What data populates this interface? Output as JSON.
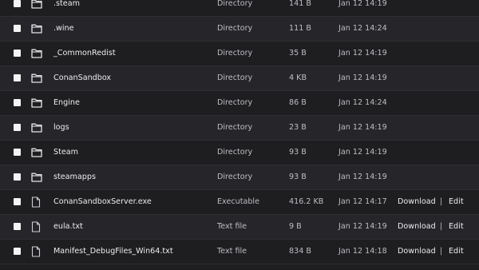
{
  "colors": {
    "background": "#1e1e21",
    "row_alt": "#26262a",
    "folder_icon": "#e6e6e8",
    "file_icon": "#cfcfd4"
  },
  "actions": {
    "download_label": "Download",
    "separator": "|",
    "edit_label": "Edit"
  },
  "files": [
    {
      "name": ".steam",
      "type": "Directory",
      "size": "141 B",
      "date": "Jan 12 14:19",
      "icon": "folder-icon"
    },
    {
      "name": ".wine",
      "type": "Directory",
      "size": "111 B",
      "date": "Jan 12 14:24",
      "icon": "folder-icon"
    },
    {
      "name": "_CommonRedist",
      "type": "Directory",
      "size": "35 B",
      "date": "Jan 12 14:19",
      "icon": "folder-icon"
    },
    {
      "name": "ConanSandbox",
      "type": "Directory",
      "size": "4 KB",
      "date": "Jan 12 14:19",
      "icon": "folder-icon"
    },
    {
      "name": "Engine",
      "type": "Directory",
      "size": "86 B",
      "date": "Jan 12 14:24",
      "icon": "folder-icon"
    },
    {
      "name": "logs",
      "type": "Directory",
      "size": "23 B",
      "date": "Jan 12 14:19",
      "icon": "folder-icon"
    },
    {
      "name": "Steam",
      "type": "Directory",
      "size": "93 B",
      "date": "Jan 12 14:19",
      "icon": "folder-icon"
    },
    {
      "name": "steamapps",
      "type": "Directory",
      "size": "93 B",
      "date": "Jan 12 14:19",
      "icon": "folder-icon"
    },
    {
      "name": "ConanSandboxServer.exe",
      "type": "Executable",
      "size": "416.2 KB",
      "date": "Jan 12 14:17",
      "icon": "file-icon"
    },
    {
      "name": "eula.txt",
      "type": "Text file",
      "size": "9 B",
      "date": "Jan 12 14:19",
      "icon": "file-icon"
    },
    {
      "name": "Manifest_DebugFiles_Win64.txt",
      "type": "Text file",
      "size": "834 B",
      "date": "Jan 12 14:18",
      "icon": "file-icon"
    }
  ]
}
